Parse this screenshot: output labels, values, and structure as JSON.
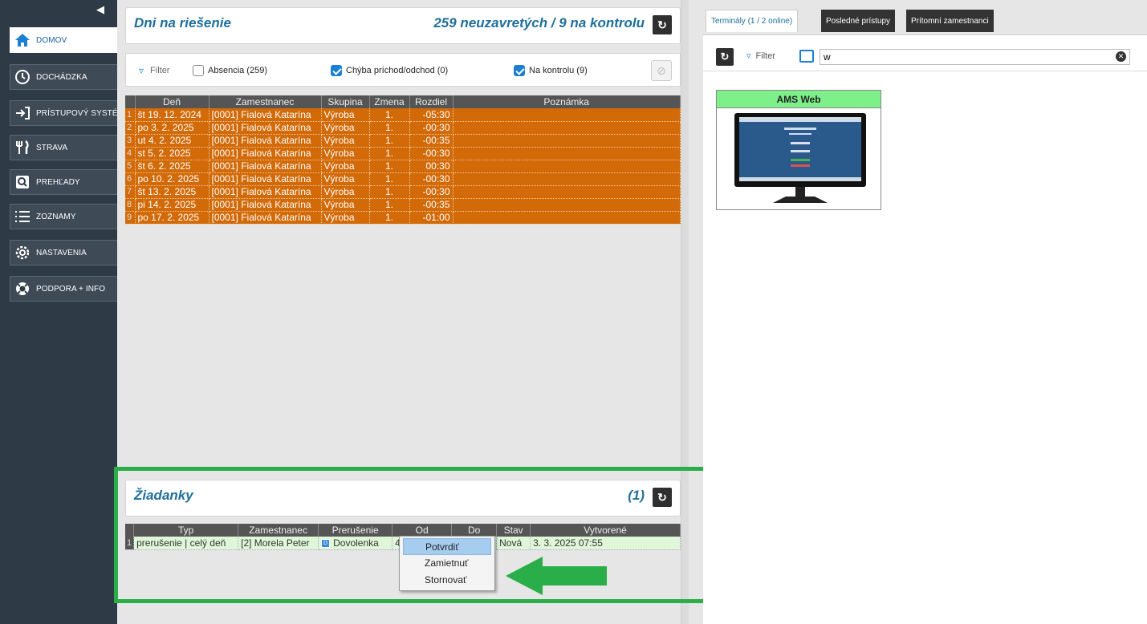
{
  "sidebar": {
    "items": [
      {
        "label": "DOMOV",
        "icon": "home-icon",
        "active": true
      },
      {
        "label": "DOCHÁDZKA",
        "icon": "clock-icon"
      },
      {
        "label": "PRÍSTUPOVÝ SYSTÉM",
        "icon": "login-arrow-icon"
      },
      {
        "label": "STRAVA",
        "icon": "cutlery-icon"
      },
      {
        "label": "PREHĽADY",
        "icon": "search-icon"
      },
      {
        "label": "ZOZNAMY",
        "icon": "list-icon"
      },
      {
        "label": "NASTAVENIA",
        "icon": "gear-icon"
      },
      {
        "label": "PODPORA + INFO",
        "icon": "lifebuoy-icon"
      }
    ]
  },
  "days_panel": {
    "title": "Dni na riešenie",
    "count": "259 neuzavretých / 9 na kontrolu",
    "filter_label": "Filter",
    "filters": [
      {
        "label": "Absencia (259)",
        "checked": false
      },
      {
        "label": "Chýba príchod/odchod (0)",
        "checked": true
      },
      {
        "label": "Na kontrolu (9)",
        "checked": true
      }
    ],
    "columns": [
      "Deň",
      "Zamestnanec",
      "Skupina",
      "Zmena",
      "Rozdiel",
      "Poznámka"
    ],
    "rows": [
      [
        "1",
        "št 19. 12. 2024",
        "[0001] Fialová Katarína",
        "Výroba",
        "1.",
        "-05:30",
        ""
      ],
      [
        "2",
        "po 3. 2. 2025",
        "[0001] Fialová Katarína",
        "Výroba",
        "1.",
        "-00:30",
        ""
      ],
      [
        "3",
        "ut 4. 2. 2025",
        "[0001] Fialová Katarína",
        "Výroba",
        "1.",
        "-00:35",
        ""
      ],
      [
        "4",
        "st 5. 2. 2025",
        "[0001] Fialová Katarína",
        "Výroba",
        "1.",
        "-00:30",
        ""
      ],
      [
        "5",
        "št 6. 2. 2025",
        "[0001] Fialová Katarína",
        "Výroba",
        "1.",
        "00:30",
        ""
      ],
      [
        "6",
        "po 10. 2. 2025",
        "[0001] Fialová Katarína",
        "Výroba",
        "1.",
        "-00:30",
        ""
      ],
      [
        "7",
        "št 13. 2. 2025",
        "[0001] Fialová Katarína",
        "Výroba",
        "1.",
        "-00:30",
        ""
      ],
      [
        "8",
        "pi 14. 2. 2025",
        "[0001] Fialová Katarína",
        "Výroba",
        "1.",
        "-00:35",
        ""
      ],
      [
        "9",
        "po 17. 2. 2025",
        "[0001] Fialová Katarína",
        "Výroba",
        "1.",
        "-01:00",
        ""
      ]
    ]
  },
  "requests_panel": {
    "title": "Žiadanky",
    "count": "(1)",
    "columns": [
      "Typ",
      "Zamestnanec",
      "Prerušenie",
      "Od",
      "Do",
      "Stav",
      "Vytvorené"
    ],
    "rows": [
      {
        "num": "1",
        "typ": "prerušenie | celý deň",
        "zamestnanec": "[2] Morela Peter",
        "tag": "D",
        "prerusenie": "Dovolenka",
        "od": "4",
        "do": "",
        "stav": "Nová",
        "vytvorene": "3. 3. 2025  07:55"
      }
    ]
  },
  "context_menu": {
    "items": [
      "Potvrdiť",
      "Zamietnuť",
      "Stornovať"
    ]
  },
  "right_panel": {
    "tabs": [
      "Terminály (1 / 2 online)",
      "Posledné prístupy",
      "Prítomní zamestnanci"
    ],
    "filter_label": "Filter",
    "search_value": "w",
    "terminal_title": "AMS Web"
  },
  "colors": {
    "accent": "#1f6f9b",
    "row_orange": "#d26a08",
    "highlight_green": "#29ae49",
    "terminal_online": "#7df08a"
  }
}
